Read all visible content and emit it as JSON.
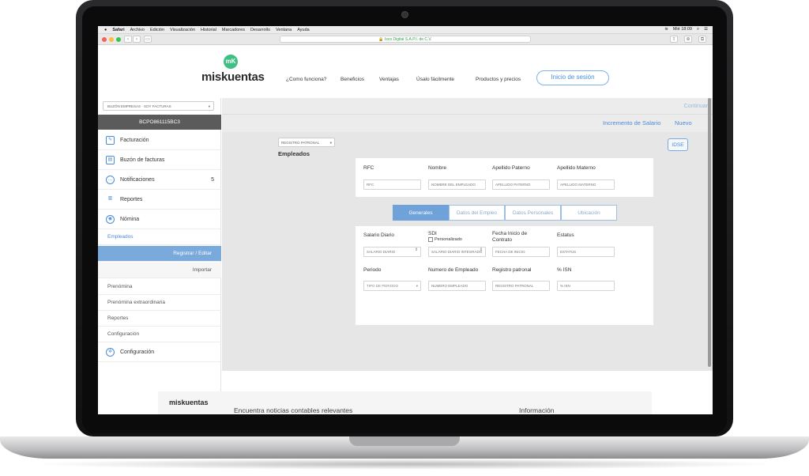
{
  "menubar": {
    "apple": "",
    "items": [
      "Safari",
      "Archivo",
      "Edición",
      "Visualización",
      "Historial",
      "Marcadores",
      "Desarrollo",
      "Ventana",
      "Ayuda"
    ],
    "clock": "Mié 18:09"
  },
  "browser": {
    "url": "🔒 Isco Digital S.A.P.I. de C.V."
  },
  "header": {
    "logo_mark": "mK",
    "logo": "miskuentas",
    "nav": [
      "¿Como funciona?",
      "Beneficios",
      "Ventajas",
      "Úsalo fácilmente",
      "Productos y precios"
    ],
    "login": "Inicio de sesión"
  },
  "sidebar": {
    "company_select": "BUZÓN EMPRESAS · SOY FACTURAS",
    "rfc": "BCPO861115BC3",
    "items": [
      {
        "label": "Facturación",
        "icon": "edit-icon"
      },
      {
        "label": "Buzón de facturas",
        "icon": "inbox-icon"
      },
      {
        "label": "Notificaciones",
        "icon": "chat-icon",
        "badge": "5"
      },
      {
        "label": "Reportes",
        "icon": "chart-icon"
      },
      {
        "label": "Nómina",
        "icon": "payroll-icon"
      }
    ],
    "empleados": "Empleados",
    "registrar": "Registrar / Editar",
    "importar": "Importar",
    "subitems": [
      "Prenómina",
      "Prenómina extraordinaria",
      "Reportes",
      "Configuración"
    ],
    "configuracion": "Configuración"
  },
  "main": {
    "continuar": "Continuar",
    "incremento": "Incremento de Salario",
    "nuevo": "Nuevo",
    "registro_select": "REGISTRO PATRONAL",
    "title": "Empleados",
    "idse": "IDSE",
    "id_labels": [
      "RFC",
      "Nombre",
      "Apellido Paterno",
      "Apellido Materno"
    ],
    "id_placeholders": [
      "RFC",
      "NOMBRE DEL EMPLEADO",
      "APELLIDO PATERNO",
      "APELLIDO MATERNO"
    ],
    "tabs": [
      "Generales",
      "Datos del Empleo",
      "Datos Personales",
      "Ubicación"
    ],
    "row1_labels": [
      "Salario Diario",
      "SDI",
      "Fecha Inicio de Contrato",
      "Estatus"
    ],
    "sdi_check": "Personalizado",
    "row1_placeholders": [
      "SALARIO DIARIO",
      "SALARIO DIARIO INTEGRADO",
      "FECHA DE INICIO",
      "ESTATUS"
    ],
    "row2_labels": [
      "Periodo",
      "Numero de Empleado",
      "Registro patronal",
      "% ISN"
    ],
    "row2_placeholders": [
      "TIPO DE PERIODO",
      "NUMERO EMPLEADO",
      "REGISTRO PATRONAL",
      "% ISN"
    ]
  },
  "footer": {
    "logo": "miskuentas",
    "news": "Encuentra noticias contables relevantes",
    "info": "Información"
  },
  "colors": {
    "accent": "#4b8bd6",
    "brand_green": "#3fbf83"
  }
}
